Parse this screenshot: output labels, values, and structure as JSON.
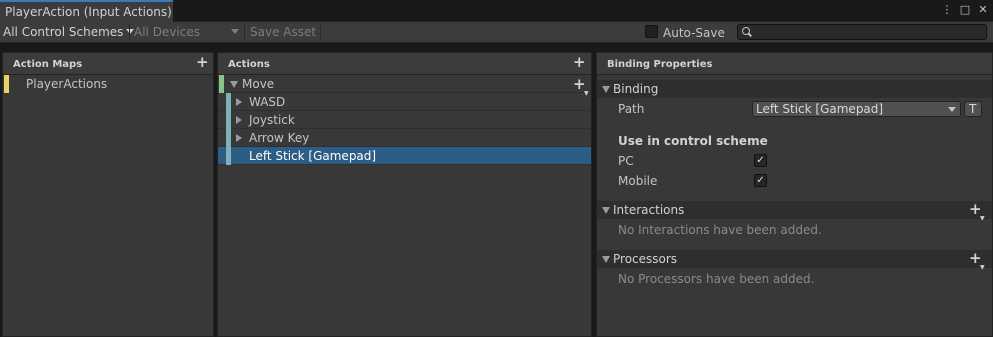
{
  "window": {
    "tab_title": "PlayerAction (Input Actions)",
    "title_icons": [
      "more-icon",
      "maximize-icon",
      "close-icon"
    ]
  },
  "toolbar": {
    "control_schemes": "All Control Schemes",
    "devices": "All Devices",
    "save_asset": "Save Asset",
    "auto_save": "Auto-Save",
    "auto_save_checked": false,
    "search_placeholder": ""
  },
  "action_maps": {
    "header": "Action Maps",
    "items": [
      {
        "label": "PlayerActions",
        "color": "#e8d06a"
      }
    ]
  },
  "actions": {
    "header": "Actions",
    "action": {
      "label": "Move",
      "color": "#86c48a"
    },
    "bindings": [
      {
        "label": "WASD",
        "expandable": true
      },
      {
        "label": "Joystick",
        "expandable": true
      },
      {
        "label": "Arrow Key",
        "expandable": true
      },
      {
        "label": "Left Stick [Gamepad]",
        "expandable": false,
        "selected": true
      }
    ],
    "binding_color": "#7fb1b8",
    "selected_color": "#2c5d87"
  },
  "binding_properties": {
    "header": "Binding Properties",
    "binding_section": "Binding",
    "path_label": "Path",
    "path_value": "Left Stick [Gamepad]",
    "path_t_button": "T",
    "use_in_scheme": "Use in control scheme",
    "schemes": [
      {
        "label": "PC",
        "checked": true
      },
      {
        "label": "Mobile",
        "checked": true
      }
    ],
    "interactions_section": "Interactions",
    "interactions_empty": "No Interactions have been added.",
    "processors_section": "Processors",
    "processors_empty": "No Processors have been added."
  }
}
